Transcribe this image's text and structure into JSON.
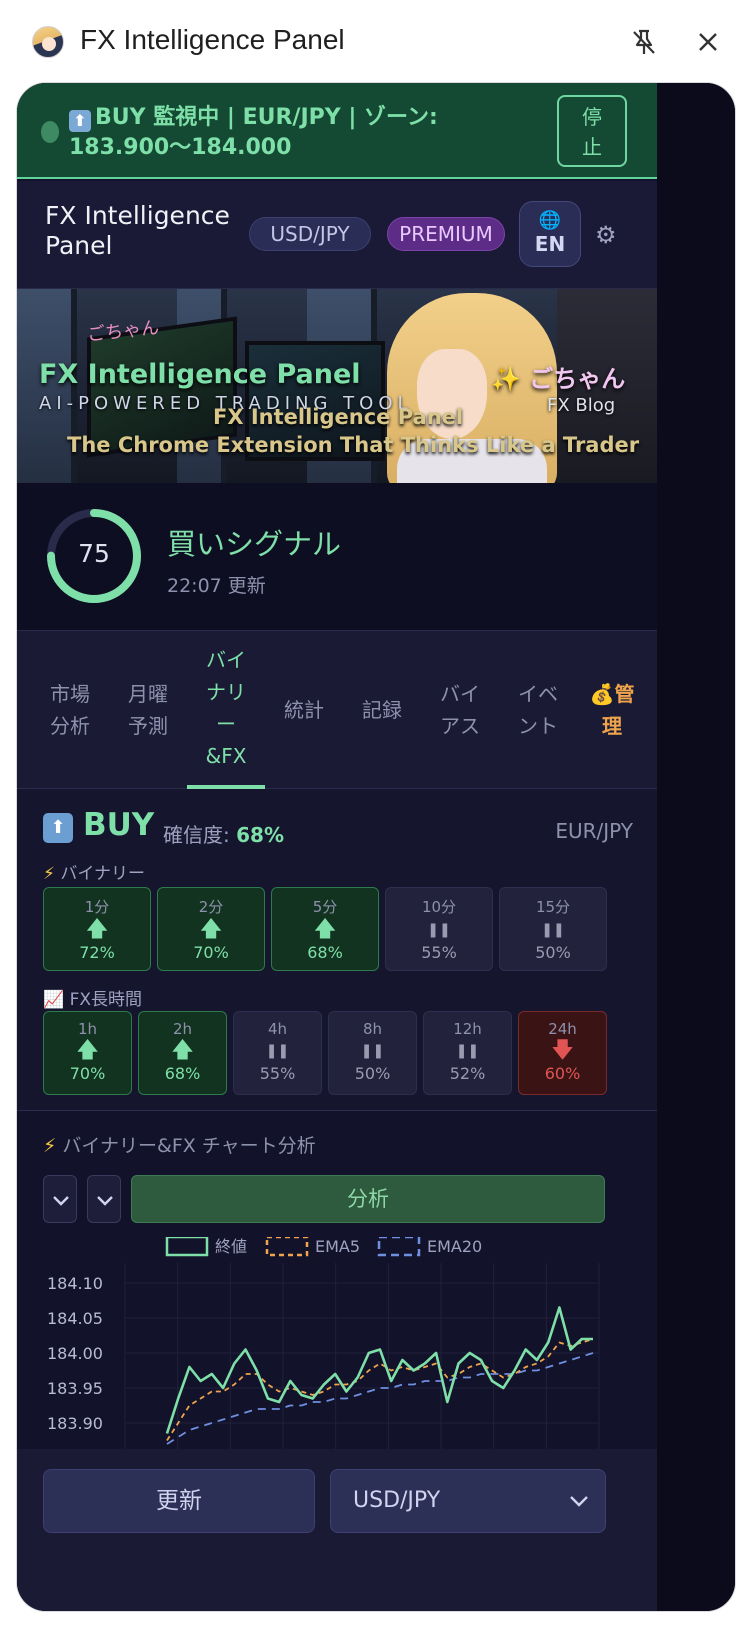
{
  "chrome": {
    "title": "FX Intelligence Panel",
    "pin_icon": "unpin-icon",
    "close_icon": "close-icon"
  },
  "monitor": {
    "icon": "⬆",
    "text": "BUY 監視中 | EUR/JPY | ゾーン: 183.900〜184.000",
    "stop_label_1": "停",
    "stop_label_2": "止"
  },
  "header": {
    "title": "FX Intelligence Panel",
    "pair_chip": "USD/JPY",
    "premium_chip": "PREMIUM",
    "lang": "EN",
    "globe_icon": "🌐",
    "gear_icon": "⚙"
  },
  "banner": {
    "logo": "ごちゃん",
    "title": "FX Intelligence Panel",
    "subtitle": "AI-POWERED TRADING TOOL",
    "brand": "✨ ごちゃん",
    "blog": "FX Blog",
    "ext_title": "FX Intelligence Panel",
    "ext_tagline": "The Chrome Extension That Thinks Like a Trader"
  },
  "signal": {
    "score": "75",
    "score_value": 75,
    "title": "買いシグナル",
    "time": "22:07 更新"
  },
  "tabs": [
    {
      "label": "市場分析"
    },
    {
      "label": "月曜予測"
    },
    {
      "label": "バイナリー&FX",
      "active": true
    },
    {
      "label": "統計"
    },
    {
      "label": "記録"
    },
    {
      "label": "バイアス"
    },
    {
      "label": "イベント"
    },
    {
      "label": "💰管理",
      "admin": true
    }
  ],
  "prediction": {
    "direction_icon": "⬆",
    "direction": "BUY",
    "confidence_label": "確信度: ",
    "confidence": "68%",
    "pair": "EUR/JPY",
    "binary_label": "バイナリー",
    "binary_icon": "⚡",
    "fx_label": "FX長時間",
    "fx_icon": "📈",
    "binary": [
      {
        "time": "1分",
        "dir": "up",
        "pct": "72%"
      },
      {
        "time": "2分",
        "dir": "up",
        "pct": "70%"
      },
      {
        "time": "5分",
        "dir": "up",
        "pct": "68%"
      },
      {
        "time": "10分",
        "dir": "neutral",
        "pct": "55%"
      },
      {
        "time": "15分",
        "dir": "neutral",
        "pct": "50%"
      }
    ],
    "fx": [
      {
        "time": "1h",
        "dir": "up",
        "pct": "70%"
      },
      {
        "time": "2h",
        "dir": "up",
        "pct": "68%"
      },
      {
        "time": "4h",
        "dir": "neutral",
        "pct": "55%"
      },
      {
        "time": "8h",
        "dir": "neutral",
        "pct": "50%"
      },
      {
        "time": "12h",
        "dir": "neutral",
        "pct": "52%"
      },
      {
        "time": "24h",
        "dir": "down",
        "pct": "60%"
      }
    ]
  },
  "analysis": {
    "icon": "⚡",
    "title": "バイナリー&FX チャート分析",
    "analyze_label": "分析"
  },
  "chart_data": {
    "type": "line",
    "yticks": [
      "184.10",
      "184.05",
      "184.00",
      "183.95",
      "183.90"
    ],
    "ylim": [
      183.88,
      184.12
    ],
    "series": [
      {
        "name": "終値",
        "color": "#7ee0a8",
        "values": [
          183.885,
          183.935,
          183.98,
          183.96,
          183.97,
          183.95,
          183.985,
          184.005,
          183.975,
          183.935,
          183.93,
          183.96,
          183.94,
          183.935,
          183.955,
          183.97,
          183.945,
          183.965,
          184.0,
          184.005,
          183.96,
          183.99,
          183.975,
          183.985,
          184.0,
          183.93,
          183.985,
          184.0,
          183.99,
          183.96,
          183.95,
          183.975,
          184.005,
          183.99,
          184.015,
          184.065,
          184.005,
          184.02,
          184.02
        ]
      },
      {
        "name": "EMA5",
        "color": "#f0a44c",
        "values": [
          183.875,
          183.9,
          183.925,
          183.935,
          183.945,
          183.945,
          183.955,
          183.97,
          183.97,
          183.955,
          183.945,
          183.95,
          183.945,
          183.94,
          183.945,
          183.955,
          183.955,
          183.96,
          183.975,
          183.985,
          183.975,
          183.98,
          183.975,
          183.98,
          183.985,
          183.965,
          183.97,
          183.98,
          183.985,
          183.975,
          183.965,
          183.97,
          183.98,
          183.985,
          183.995,
          184.015,
          184.01,
          184.015,
          184.02
        ]
      },
      {
        "name": "EMA20",
        "color": "#6f8fe0",
        "values": [
          183.87,
          183.88,
          183.89,
          183.895,
          183.9,
          183.905,
          183.91,
          183.915,
          183.92,
          183.92,
          183.92,
          183.925,
          183.925,
          183.93,
          183.93,
          183.935,
          183.935,
          183.94,
          183.945,
          183.95,
          183.95,
          183.955,
          183.955,
          183.96,
          183.96,
          183.96,
          183.965,
          183.965,
          183.97,
          183.97,
          183.97,
          183.97,
          183.975,
          183.975,
          183.98,
          183.985,
          183.99,
          183.995,
          184.0
        ]
      }
    ]
  },
  "footer": {
    "refresh_label": "更新",
    "pair_select": "USD/JPY"
  }
}
